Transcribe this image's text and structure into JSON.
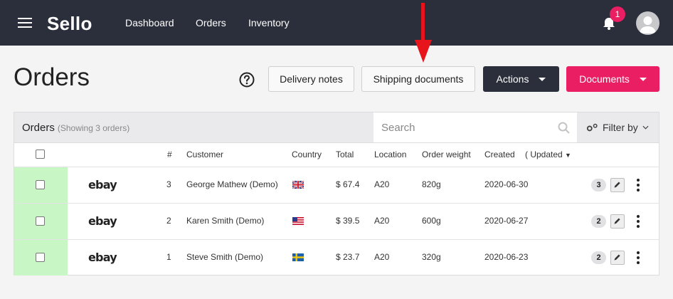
{
  "app": {
    "logo": "Sello",
    "nav": [
      "Dashboard",
      "Orders",
      "Inventory"
    ],
    "notification_count": "1"
  },
  "header": {
    "title": "Orders",
    "delivery_notes": "Delivery notes",
    "shipping_documents": "Shipping documents",
    "actions": "Actions",
    "documents": "Documents"
  },
  "panel": {
    "title": "Orders",
    "subtitle": "(Showing 3 orders)",
    "search_placeholder": "Search",
    "filter_label": "Filter by"
  },
  "columns": {
    "num": "#",
    "customer": "Customer",
    "country": "Country",
    "total": "Total",
    "location": "Location",
    "weight": "Order weight",
    "created": "Created",
    "updated": "( Updated"
  },
  "orders": [
    {
      "channel": "ebay",
      "num": "3",
      "customer": "George Mathew (Demo)",
      "country": "gb-flag",
      "total": "$ 67.4",
      "location": "A20",
      "weight": "820g",
      "created": "2020-06-30",
      "count": "3"
    },
    {
      "channel": "ebay",
      "num": "2",
      "customer": "Karen Smith (Demo)",
      "country": "us-flag",
      "total": "$ 39.5",
      "location": "A20",
      "weight": "600g",
      "created": "2020-06-27",
      "count": "2"
    },
    {
      "channel": "ebay",
      "num": "1",
      "customer": "Steve Smith (Demo)",
      "country": "se-flag",
      "total": "$ 23.7",
      "location": "A20",
      "weight": "320g",
      "created": "2020-06-23",
      "count": "2"
    }
  ],
  "colors": {
    "topbar": "#2b2e3b",
    "accent_pink": "#e91e63",
    "row_highlight": "#c8f7c5",
    "arrow": "#e8141b"
  }
}
